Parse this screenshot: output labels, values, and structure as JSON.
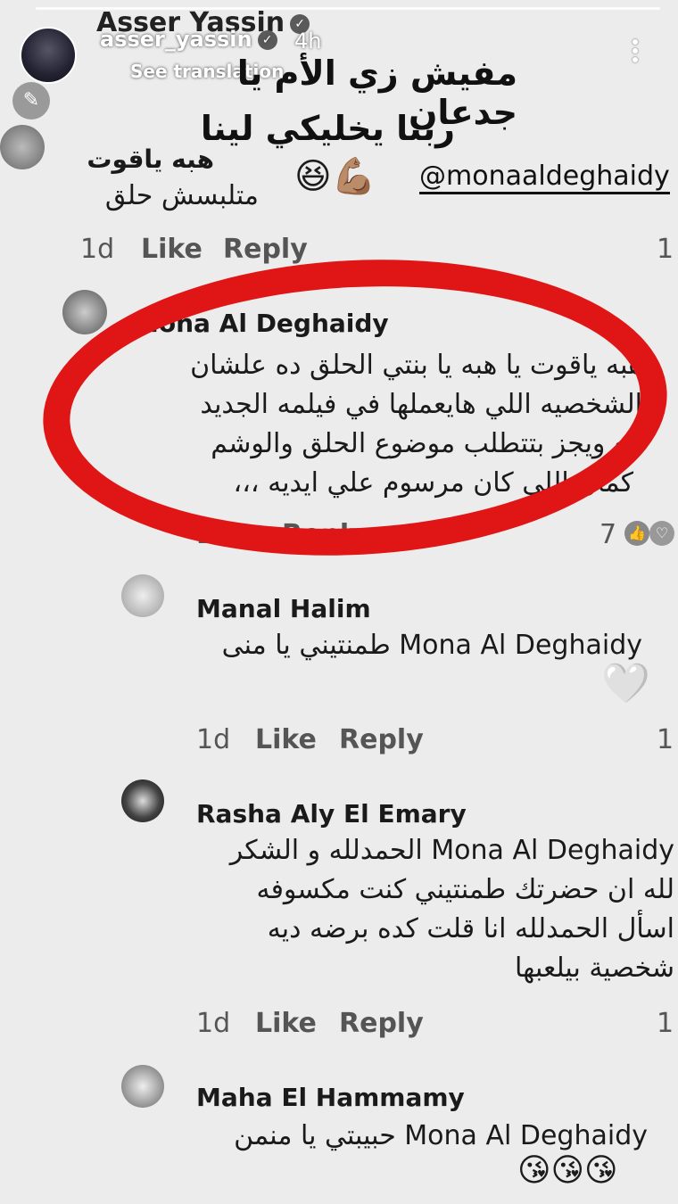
{
  "story": {
    "name": "Asser Yassin",
    "handle": "asser_yassin",
    "time": "4h",
    "see_translation": "See translation",
    "caption_line1": "مفيش زي الأم يا جدعان",
    "caption_line2": "ربنا يخليكي لينا",
    "mention": "@monaaldeghaidy",
    "emojis": "😆💪🏽"
  },
  "comments": [
    {
      "name": "هبه ياقوت",
      "text": "متلبسش حلق",
      "time": "1d",
      "like": "Like",
      "reply": "Reply",
      "count": "1"
    },
    {
      "name": "Mona Al Deghaidy",
      "text_l1": "هبه ياقوت يا هبه يا بنتي الحلق ده علشان",
      "text_l2": "الشخصيه اللي هايعملها في فيلمه الجديد",
      "text_l3": "مع ويجز بتتطلب موضوع الحلق والوشم",
      "text_l4": "كمان اللي كان مرسوم علي ايديه ،،،",
      "like": "Like",
      "reply": "Reply",
      "count": "7"
    },
    {
      "name": "Manal Halim",
      "text": "Mona Al Deghaidy طمنتيني يا منى",
      "time": "1d",
      "like": "Like",
      "reply": "Reply",
      "count": "1"
    },
    {
      "name": "Rasha Aly El Emary",
      "text_l1": "Mona Al Deghaidy الحمدلله و الشكر",
      "text_l2": "لله ان حضرتك طمنتيني  كنت مكسوفه",
      "text_l3": "اسأل الحمدلله انا قلت كده برضه ديه",
      "text_l4": "شخصية بيلعبها",
      "time": "1d",
      "like": "Like",
      "reply": "Reply",
      "count": "1"
    },
    {
      "name": "Maha El Hammamy",
      "text": "Mona Al Deghaidy حبيبتي يا منمن",
      "emojis": "😘😘😘"
    }
  ],
  "colors": {
    "highlight": "#e01515",
    "background": "#ececec"
  }
}
